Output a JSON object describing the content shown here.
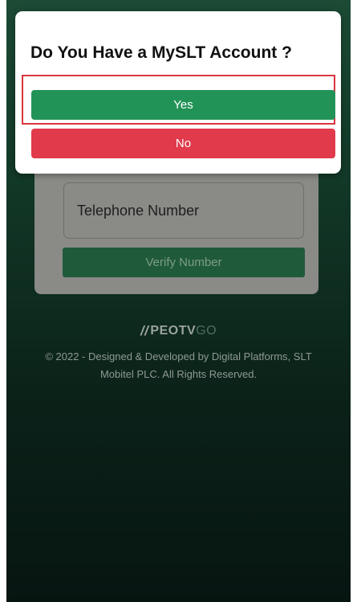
{
  "dialog": {
    "title": "Do You Have a MySLT Account ?",
    "yes_label": "Yes",
    "no_label": "No"
  },
  "form": {
    "telephone_label": "Telephone Number",
    "verify_label": "Verify Number"
  },
  "brand": {
    "mark": "//",
    "name": "PEOTV",
    "suffix": "GO"
  },
  "footer": {
    "line1": "© 2022 - Designed & Developed by Digital Platforms, SLT",
    "line2": "Mobitel PLC. All Rights Reserved."
  },
  "colors": {
    "yes": "#229357",
    "no": "#e03a4b",
    "highlight": "#d9363e",
    "background": "#123827"
  }
}
